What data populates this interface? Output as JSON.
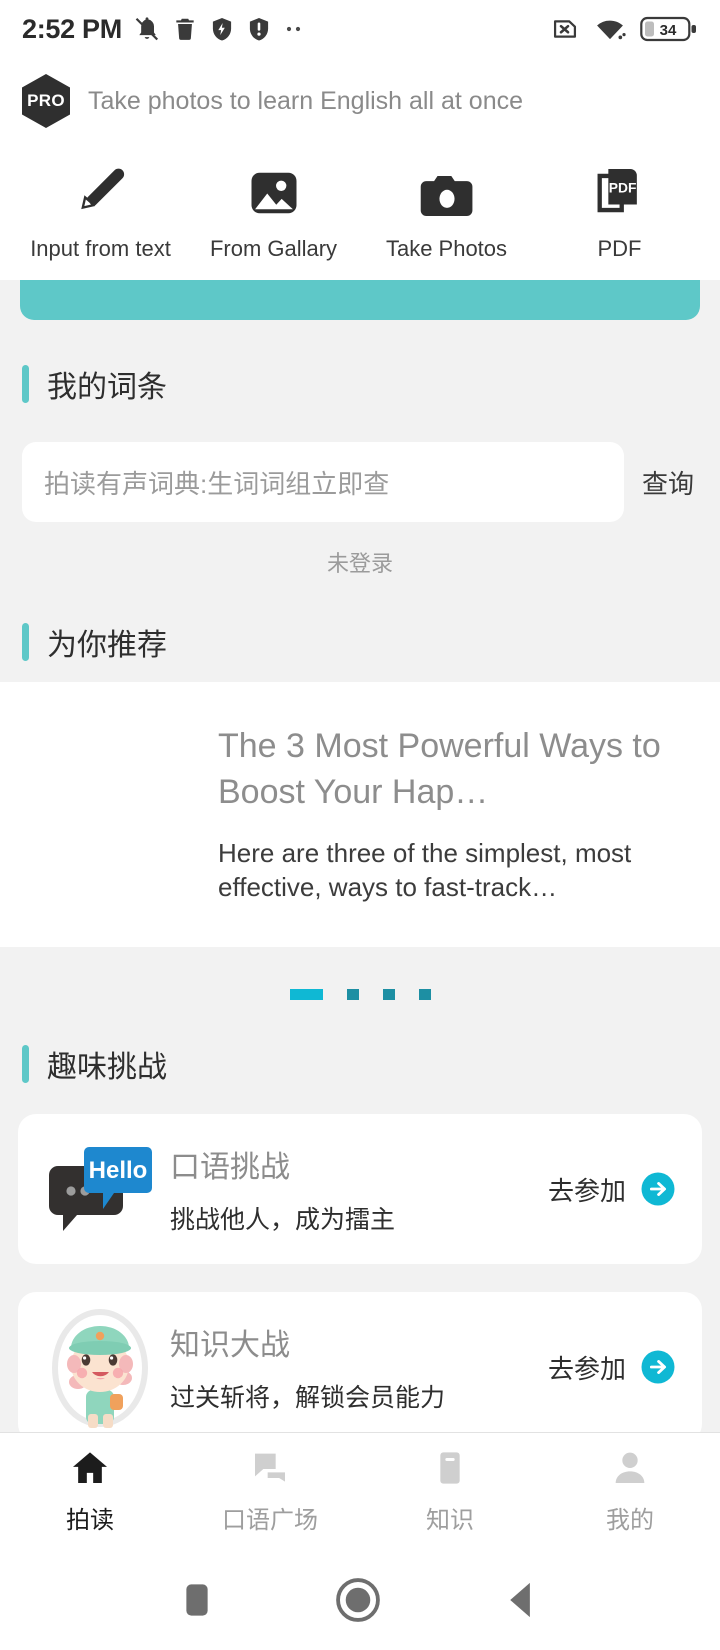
{
  "status_bar": {
    "time": "2:52 PM",
    "left_icons": [
      "bell-muted-icon",
      "trash-icon",
      "shield-bolt-icon",
      "shield-alert-icon",
      "more-dots-icon"
    ],
    "right_icons": [
      "sim-missing-icon",
      "wifi-icon"
    ],
    "battery_percent": "34"
  },
  "pro_header": {
    "badge_label": "PRO",
    "tagline": "Take photos to learn English all at once"
  },
  "actions": [
    {
      "icon": "pencil-icon",
      "label": "Input from text"
    },
    {
      "icon": "image-icon",
      "label": "From Gallary"
    },
    {
      "icon": "camera-icon",
      "label": "Take Photos"
    },
    {
      "icon": "pdf-icon",
      "label": "PDF"
    }
  ],
  "my_entries": {
    "section_title": "我的词条",
    "search_placeholder": "拍读有声词典:生词词组立即查",
    "search_value": "",
    "search_button": "查询",
    "login_state": "未登录"
  },
  "recommend": {
    "section_title": "为你推荐",
    "card": {
      "title": "The 3 Most Powerful Ways to Boost Your Hap…",
      "description": "Here are three of the simplest, most effective, ways to fast-track…"
    },
    "dots_total": 4,
    "dots_active_index": 0
  },
  "challenges": {
    "section_title": "趣味挑战",
    "items": [
      {
        "icon": "hello-chat-bubble-icon",
        "title": "口语挑战",
        "subtitle": "挑战他人，成为擂主",
        "cta": "去参加",
        "cta_icon": "arrow-right-circle-icon"
      },
      {
        "icon": "mascot-avatar-icon",
        "title": "知识大战",
        "subtitle": "过关斩将，解锁会员能力",
        "cta": "去参加",
        "cta_icon": "arrow-right-circle-icon"
      }
    ]
  },
  "bottom_nav": [
    {
      "icon": "home-icon",
      "label": "拍读",
      "active": true
    },
    {
      "icon": "chat-icon",
      "label": "口语广场",
      "active": false
    },
    {
      "icon": "book-icon",
      "label": "知识",
      "active": false
    },
    {
      "icon": "person-icon",
      "label": "我的",
      "active": false
    }
  ],
  "system_bar": {
    "buttons": [
      "recent-apps-icon",
      "home-circle-icon",
      "back-icon"
    ]
  },
  "colors": {
    "teal": "#5ec8c8",
    "accent_cyan": "#0fb8d4",
    "dot_inactive": "#1d8fa3",
    "hello_blue": "#1e88cf",
    "page_bg": "#f2f2f2",
    "card_bg": "#ffffff"
  }
}
